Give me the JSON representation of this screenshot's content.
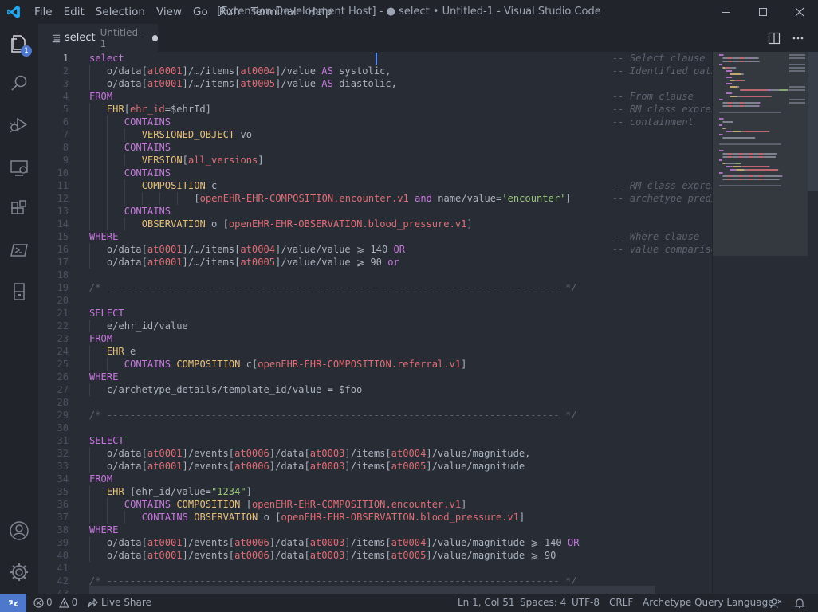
{
  "titlebar": {
    "menu": [
      "File",
      "Edit",
      "Selection",
      "View",
      "Go",
      "Run",
      "Terminal",
      "Help"
    ],
    "title": "[Extension Development Host] - ● select • Untitled-1 - Visual Studio Code"
  },
  "activity": {
    "icons": [
      "explorer-icon",
      "search-icon",
      "run-debug-icon",
      "remote-explorer-icon",
      "extensions-icon",
      "powershell-icon",
      "database-icon",
      "account-icon",
      "settings-gear-icon"
    ],
    "explorer_badge": "1"
  },
  "tab": {
    "name": "select",
    "description": "Untitled-1"
  },
  "editor": {
    "cursor": {
      "line": 1,
      "col": 51
    },
    "lines": [
      {
        "n": "1",
        "indent": 0,
        "tokens": [
          [
            "kw",
            "select"
          ]
        ],
        "comment": "-- Select clause"
      },
      {
        "n": "2",
        "indent": 1,
        "tokens": [
          [
            "p",
            "o/data["
          ],
          [
            "red",
            "at0001"
          ],
          [
            "p",
            "]/…/items["
          ],
          [
            "red",
            "at0004"
          ],
          [
            "p",
            "]/value "
          ],
          [
            "kw",
            "AS"
          ],
          [
            "p",
            " systolic,"
          ]
        ],
        "comment": "-- Identified path with"
      },
      {
        "n": "3",
        "indent": 1,
        "tokens": [
          [
            "p",
            "o/data["
          ],
          [
            "red",
            "at0001"
          ],
          [
            "p",
            "]/…/items["
          ],
          [
            "red",
            "at0005"
          ],
          [
            "p",
            "]/value "
          ],
          [
            "kw",
            "AS"
          ],
          [
            "p",
            " diastolic,"
          ]
        ],
        "comment": ""
      },
      {
        "n": "4",
        "indent": 0,
        "tokens": [
          [
            "kw",
            "FROM"
          ]
        ],
        "comment": "-- From clause"
      },
      {
        "n": "5",
        "indent": 1,
        "tokens": [
          [
            "type",
            "EHR"
          ],
          [
            "p",
            "["
          ],
          [
            "red",
            "ehr_id"
          ],
          [
            "p",
            "=$ehrId]"
          ]
        ],
        "comment": "-- RM class expression"
      },
      {
        "n": "6",
        "indent": 2,
        "tokens": [
          [
            "kw",
            "CONTAINS"
          ]
        ],
        "comment": "-- containment"
      },
      {
        "n": "7",
        "indent": 3,
        "tokens": [
          [
            "type",
            "VERSIONED_OBJECT"
          ],
          [
            "p",
            " vo"
          ]
        ],
        "comment": ""
      },
      {
        "n": "8",
        "indent": 2,
        "tokens": [
          [
            "kw",
            "CONTAINS"
          ]
        ],
        "comment": ""
      },
      {
        "n": "9",
        "indent": 3,
        "tokens": [
          [
            "type",
            "VERSION"
          ],
          [
            "p",
            "["
          ],
          [
            "red",
            "all_versions"
          ],
          [
            "p",
            "]"
          ]
        ],
        "comment": ""
      },
      {
        "n": "10",
        "indent": 2,
        "tokens": [
          [
            "kw",
            "CONTAINS"
          ]
        ],
        "comment": ""
      },
      {
        "n": "11",
        "indent": 3,
        "tokens": [
          [
            "type",
            "COMPOSITION"
          ],
          [
            "p",
            " c"
          ]
        ],
        "comment": "-- RM class expression"
      },
      {
        "n": "12",
        "indent": 6,
        "tokens": [
          [
            "p",
            "["
          ],
          [
            "red",
            "openEHR-EHR-COMPOSITION.encounter.v1"
          ],
          [
            "p",
            " "
          ],
          [
            "kw",
            "and"
          ],
          [
            "p",
            " name/value="
          ],
          [
            "str",
            "'encounter'"
          ],
          [
            "p",
            "]"
          ]
        ],
        "comment": "-- archetype predicate"
      },
      {
        "n": "13",
        "indent": 2,
        "tokens": [
          [
            "kw",
            "CONTAINS"
          ]
        ],
        "comment": ""
      },
      {
        "n": "14",
        "indent": 3,
        "tokens": [
          [
            "type",
            "OBSERVATION"
          ],
          [
            "p",
            " o ["
          ],
          [
            "red",
            "openEHR-EHR-OBSERVATION.blood_pressure.v1"
          ],
          [
            "p",
            "]"
          ]
        ],
        "comment": ""
      },
      {
        "n": "15",
        "indent": 0,
        "tokens": [
          [
            "kw",
            "WHERE"
          ]
        ],
        "comment": "-- Where clause"
      },
      {
        "n": "16",
        "indent": 1,
        "tokens": [
          [
            "p",
            "o/data["
          ],
          [
            "red",
            "at0001"
          ],
          [
            "p",
            "]/…/items["
          ],
          [
            "red",
            "at0004"
          ],
          [
            "p",
            "]/value/value ⩾ 140 "
          ],
          [
            "kw",
            "OR"
          ]
        ],
        "comment": "-- value comparison"
      },
      {
        "n": "17",
        "indent": 1,
        "tokens": [
          [
            "p",
            "o/data["
          ],
          [
            "red",
            "at0001"
          ],
          [
            "p",
            "]/…/items["
          ],
          [
            "red",
            "at0005"
          ],
          [
            "p",
            "]/value/value ⩾ 90 "
          ],
          [
            "kw",
            "or"
          ]
        ],
        "comment": ""
      },
      {
        "n": "18",
        "indent": 0,
        "tokens": [],
        "comment": ""
      },
      {
        "n": "19",
        "indent": 0,
        "tokens": [
          [
            "cm",
            "/* ------------------------------------------------------------------------------ */"
          ]
        ],
        "comment": ""
      },
      {
        "n": "20",
        "indent": 0,
        "tokens": [],
        "comment": ""
      },
      {
        "n": "21",
        "indent": 0,
        "tokens": [
          [
            "kw",
            "SELECT"
          ]
        ],
        "comment": ""
      },
      {
        "n": "22",
        "indent": 1,
        "tokens": [
          [
            "p",
            "e/ehr_id/value"
          ]
        ],
        "comment": ""
      },
      {
        "n": "23",
        "indent": 0,
        "tokens": [
          [
            "kw",
            "FROM"
          ]
        ],
        "comment": ""
      },
      {
        "n": "24",
        "indent": 1,
        "tokens": [
          [
            "type",
            "EHR"
          ],
          [
            "p",
            " e"
          ]
        ],
        "comment": ""
      },
      {
        "n": "25",
        "indent": 2,
        "tokens": [
          [
            "kw",
            "CONTAINS"
          ],
          [
            "p",
            " "
          ],
          [
            "type",
            "COMPOSITION"
          ],
          [
            "p",
            " c["
          ],
          [
            "red",
            "openEHR-EHR-COMPOSITION.referral.v1"
          ],
          [
            "p",
            "]"
          ]
        ],
        "comment": ""
      },
      {
        "n": "26",
        "indent": 0,
        "tokens": [
          [
            "kw",
            "WHERE"
          ]
        ],
        "comment": ""
      },
      {
        "n": "27",
        "indent": 1,
        "tokens": [
          [
            "p",
            "c/archetype_details/template_id/value = $foo"
          ]
        ],
        "comment": ""
      },
      {
        "n": "28",
        "indent": 0,
        "tokens": [],
        "comment": ""
      },
      {
        "n": "29",
        "indent": 0,
        "tokens": [
          [
            "cm",
            "/* ------------------------------------------------------------------------------ */"
          ]
        ],
        "comment": ""
      },
      {
        "n": "30",
        "indent": 0,
        "tokens": [],
        "comment": ""
      },
      {
        "n": "31",
        "indent": 0,
        "tokens": [
          [
            "kw",
            "SELECT"
          ]
        ],
        "comment": ""
      },
      {
        "n": "32",
        "indent": 1,
        "tokens": [
          [
            "p",
            "o/data["
          ],
          [
            "red",
            "at0001"
          ],
          [
            "p",
            "]/events["
          ],
          [
            "red",
            "at0006"
          ],
          [
            "p",
            "]/data["
          ],
          [
            "red",
            "at0003"
          ],
          [
            "p",
            "]/items["
          ],
          [
            "red",
            "at0004"
          ],
          [
            "p",
            "]/value/magnitude,"
          ]
        ],
        "comment": ""
      },
      {
        "n": "33",
        "indent": 1,
        "tokens": [
          [
            "p",
            "o/data["
          ],
          [
            "red",
            "at0001"
          ],
          [
            "p",
            "]/events["
          ],
          [
            "red",
            "at0006"
          ],
          [
            "p",
            "]/data["
          ],
          [
            "red",
            "at0003"
          ],
          [
            "p",
            "]/items["
          ],
          [
            "red",
            "at0005"
          ],
          [
            "p",
            "]/value/magnitude"
          ]
        ],
        "comment": ""
      },
      {
        "n": "34",
        "indent": 0,
        "tokens": [
          [
            "kw",
            "FROM"
          ]
        ],
        "comment": ""
      },
      {
        "n": "35",
        "indent": 1,
        "tokens": [
          [
            "type",
            "EHR"
          ],
          [
            "p",
            " [ehr_id/value="
          ],
          [
            "str",
            "\"1234\""
          ],
          [
            "p",
            "]"
          ]
        ],
        "comment": ""
      },
      {
        "n": "36",
        "indent": 2,
        "tokens": [
          [
            "kw",
            "CONTAINS"
          ],
          [
            "p",
            " "
          ],
          [
            "type",
            "COMPOSITION"
          ],
          [
            "p",
            " ["
          ],
          [
            "red",
            "openEHR-EHR-COMPOSITION.encounter.v1"
          ],
          [
            "p",
            "]"
          ]
        ],
        "comment": ""
      },
      {
        "n": "37",
        "indent": 3,
        "tokens": [
          [
            "kw",
            "CONTAINS"
          ],
          [
            "p",
            " "
          ],
          [
            "type",
            "OBSERVATION"
          ],
          [
            "p",
            " o ["
          ],
          [
            "red",
            "openEHR-EHR-OBSERVATION.blood_pressure.v1"
          ],
          [
            "p",
            "]"
          ]
        ],
        "comment": ""
      },
      {
        "n": "38",
        "indent": 0,
        "tokens": [
          [
            "kw",
            "WHERE"
          ]
        ],
        "comment": ""
      },
      {
        "n": "39",
        "indent": 1,
        "tokens": [
          [
            "p",
            "o/data["
          ],
          [
            "red",
            "at0001"
          ],
          [
            "p",
            "]/events["
          ],
          [
            "red",
            "at0006"
          ],
          [
            "p",
            "]/data["
          ],
          [
            "red",
            "at0003"
          ],
          [
            "p",
            "]/items["
          ],
          [
            "red",
            "at0004"
          ],
          [
            "p",
            "]/value/magnitude ⩾ 140 "
          ],
          [
            "kw",
            "OR"
          ]
        ],
        "comment": ""
      },
      {
        "n": "40",
        "indent": 1,
        "tokens": [
          [
            "p",
            "o/data["
          ],
          [
            "red",
            "at0001"
          ],
          [
            "p",
            "]/events["
          ],
          [
            "red",
            "at0006"
          ],
          [
            "p",
            "]/data["
          ],
          [
            "red",
            "at0003"
          ],
          [
            "p",
            "]/items["
          ],
          [
            "red",
            "at0005"
          ],
          [
            "p",
            "]/value/magnitude ⩾ 90"
          ]
        ],
        "comment": ""
      },
      {
        "n": "41",
        "indent": 0,
        "tokens": [],
        "comment": ""
      },
      {
        "n": "42",
        "indent": 0,
        "tokens": [
          [
            "cm",
            "/* ------------------------------------------------------------------------------ */"
          ]
        ],
        "comment": ""
      },
      {
        "n": "43",
        "indent": 0,
        "tokens": [],
        "comment": ""
      }
    ]
  },
  "statusbar": {
    "errors": "0",
    "warnings": "0",
    "live_share": "Live Share",
    "position": "Ln 1, Col 51",
    "spaces": "Spaces: 4",
    "encoding": "UTF-8",
    "eol": "CRLF",
    "language": "Archetype Query Language"
  },
  "colors": {
    "accent": "#4d78cc",
    "keyword": "#c678dd",
    "type": "#e5c07b",
    "identifier": "#e06c75",
    "string": "#98c379",
    "comment": "#5c6370"
  }
}
